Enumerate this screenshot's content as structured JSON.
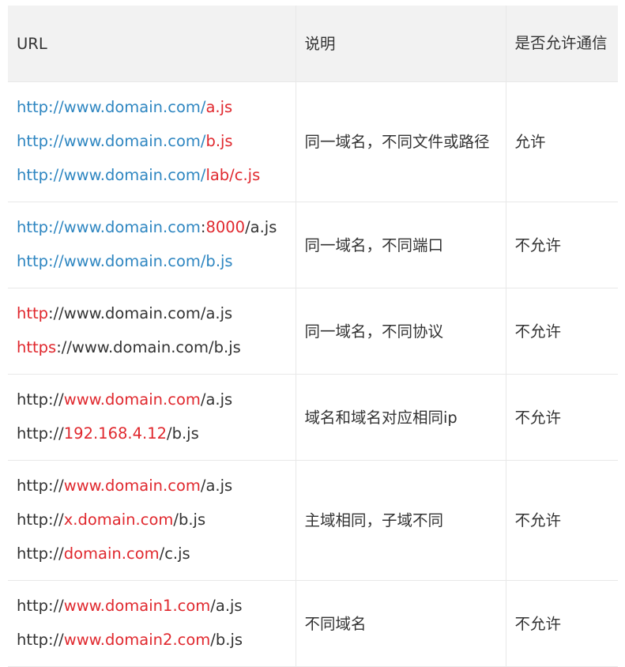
{
  "table": {
    "headers": [
      "URL",
      "说明",
      "是否允许通信"
    ],
    "rows": [
      {
        "urls": [
          [
            {
              "t": "http://www.domain.com/",
              "c": "b"
            },
            {
              "t": "a.js",
              "c": "r"
            }
          ],
          [
            {
              "t": "http://www.domain.com/",
              "c": "b"
            },
            {
              "t": "b.js",
              "c": "r"
            }
          ],
          [
            {
              "t": "http://www.domain.com/",
              "c": "b"
            },
            {
              "t": "lab/c.js",
              "c": "r"
            }
          ]
        ],
        "desc": "同一域名，不同文件或路径",
        "allow": "允许"
      },
      {
        "urls": [
          [
            {
              "t": "http://www.domain.com",
              "c": "b"
            },
            {
              "t": ":",
              "c": "k"
            },
            {
              "t": "8000",
              "c": "r"
            },
            {
              "t": "/a.js",
              "c": "k"
            }
          ],
          [
            {
              "t": "http://www.domain.com/b.js",
              "c": "b"
            }
          ]
        ],
        "desc": "同一域名，不同端口",
        "allow": "不允许"
      },
      {
        "urls": [
          [
            {
              "t": "http",
              "c": "r"
            },
            {
              "t": "://www.domain.com/a.js",
              "c": "k"
            }
          ],
          [
            {
              "t": "https",
              "c": "r"
            },
            {
              "t": "://www.domain.com/b.js",
              "c": "k"
            }
          ]
        ],
        "desc": "同一域名，不同协议",
        "allow": "不允许"
      },
      {
        "urls": [
          [
            {
              "t": "http://",
              "c": "k"
            },
            {
              "t": "www.domain.com",
              "c": "r"
            },
            {
              "t": "/a.js",
              "c": "k"
            }
          ],
          [
            {
              "t": "http://",
              "c": "k"
            },
            {
              "t": "192.168.4.12",
              "c": "r"
            },
            {
              "t": "/b.js",
              "c": "k"
            }
          ]
        ],
        "desc": "域名和域名对应相同ip",
        "allow": "不允许"
      },
      {
        "urls": [
          [
            {
              "t": "http://",
              "c": "k"
            },
            {
              "t": "www.domain.com",
              "c": "r"
            },
            {
              "t": "/a.js",
              "c": "k"
            }
          ],
          [
            {
              "t": "http://",
              "c": "k"
            },
            {
              "t": "x.domain.com",
              "c": "r"
            },
            {
              "t": "/b.js",
              "c": "k"
            }
          ],
          [
            {
              "t": "http://",
              "c": "k"
            },
            {
              "t": "domain.com",
              "c": "r"
            },
            {
              "t": "/c.js",
              "c": "k"
            }
          ]
        ],
        "desc": "主域相同，子域不同",
        "allow": "不允许"
      },
      {
        "urls": [
          [
            {
              "t": "http://",
              "c": "k"
            },
            {
              "t": "www.domain1.com",
              "c": "r"
            },
            {
              "t": "/a.js",
              "c": "k"
            }
          ],
          [
            {
              "t": "http://",
              "c": "k"
            },
            {
              "t": "www.domain2.com",
              "c": "r"
            },
            {
              "t": "/b.js",
              "c": "k"
            }
          ]
        ],
        "desc": "不同域名",
        "allow": "不允许"
      }
    ]
  },
  "colors": {
    "link_blue": "#2e86c1",
    "highlight_red": "#e0282e",
    "text": "#333333",
    "header_bg": "#f2f2f2",
    "border": "#e8e8e8"
  }
}
